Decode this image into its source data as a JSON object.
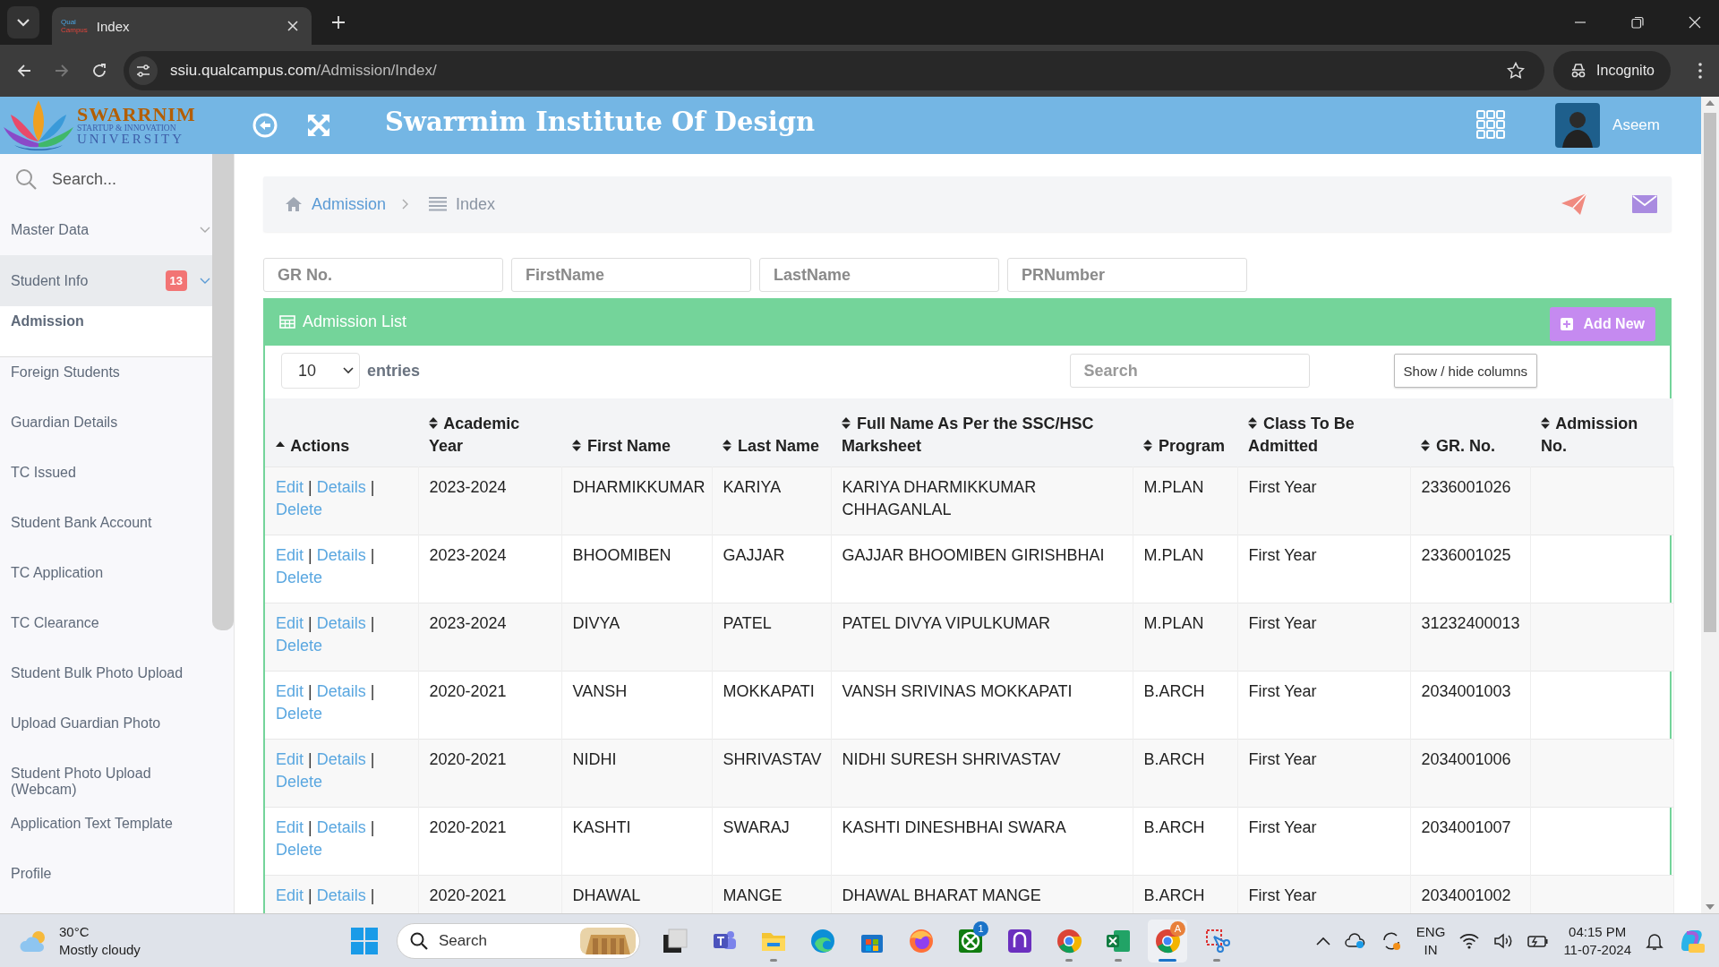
{
  "browser": {
    "tab": {
      "title": "Index",
      "favicon_top": "Qual",
      "favicon_bottom": "Campus"
    },
    "url_host": "ssiu.qualcampus.com",
    "url_path": "/Admission/Index/",
    "profile": "Incognito"
  },
  "header": {
    "logo": {
      "name": "SWARRNIM",
      "line_1": "STARTUP & INNOVATION",
      "line_2": "UNIVERSITY"
    },
    "title": "Swarrnim Institute Of Design",
    "user": "Aseem"
  },
  "sidebar": {
    "search_placeholder": "Search...",
    "items": [
      {
        "label": "Master Data",
        "expanded": false,
        "selected": false
      },
      {
        "label": "Student Info",
        "badge": "13",
        "expanded": true,
        "selected": false,
        "children": [
          {
            "label": "Admission",
            "selected": true
          },
          {
            "label": "Foreign Students",
            "selected": false
          },
          {
            "label": "Guardian Details",
            "selected": false
          },
          {
            "label": "TC Issued",
            "selected": false
          },
          {
            "label": "Student Bank Account",
            "selected": false
          },
          {
            "label": "TC Application",
            "selected": false
          },
          {
            "label": "TC Clearance",
            "selected": false
          },
          {
            "label": "Student Bulk Photo Upload",
            "selected": false
          },
          {
            "label": "Upload Guardian Photo",
            "selected": false
          },
          {
            "label": "Student Photo Upload (Webcam)",
            "selected": false
          },
          {
            "label": "Application Text Template",
            "selected": false
          },
          {
            "label": "Profile",
            "selected": false
          }
        ]
      }
    ]
  },
  "breadcrumb": [
    {
      "label": "Admission",
      "kind": "link"
    },
    {
      "label": "Index",
      "kind": "current"
    }
  ],
  "filters": [
    {
      "placeholder": "GR No."
    },
    {
      "placeholder": "FirstName"
    },
    {
      "placeholder": "LastName"
    },
    {
      "placeholder": "PRNumber"
    }
  ],
  "panel": {
    "title": "Admission List",
    "add_button": "Add New",
    "page_size": "10",
    "entries_label": "entries",
    "search_placeholder": "Search",
    "columns_button": "Show / hide columns"
  },
  "table": {
    "separator": "|",
    "columns": [
      {
        "label": "Actions",
        "sorted": true
      },
      {
        "label": "Academic Year",
        "sorted": false
      },
      {
        "label": "First Name",
        "sorted": false
      },
      {
        "label": "Last Name",
        "sorted": false
      },
      {
        "label": "Full Name As Per the SSC/HSC Marksheet",
        "sorted": false
      },
      {
        "label": "Program",
        "sorted": false
      },
      {
        "label": "Class To Be Admitted",
        "sorted": false
      },
      {
        "label": "GR. No.",
        "sorted": false
      },
      {
        "label": "Admission No.",
        "sorted": false
      }
    ],
    "rows": [
      {
        "cells": [
          [
            "Edit",
            "Details",
            "Delete"
          ],
          "2023-2024",
          "DHARMIKKUMAR",
          "KARIYA",
          "KARIYA DHARMIKKUMAR CHHAGANLAL",
          "M.PLAN",
          "First Year",
          "2336001026",
          ""
        ]
      },
      {
        "cells": [
          [
            "Edit",
            "Details",
            "Delete"
          ],
          "2023-2024",
          "BHOOMIBEN",
          "GAJJAR",
          "GAJJAR BHOOMIBEN GIRISHBHAI",
          "M.PLAN",
          "First Year",
          "2336001025",
          ""
        ]
      },
      {
        "cells": [
          [
            "Edit",
            "Details",
            "Delete"
          ],
          "2023-2024",
          "DIVYA",
          "PATEL",
          "PATEL DIVYA VIPULKUMAR",
          "M.PLAN",
          "First Year",
          "31232400013",
          ""
        ]
      },
      {
        "cells": [
          [
            "Edit",
            "Details",
            "Delete"
          ],
          "2020-2021",
          "VANSH",
          "MOKKAPATI",
          "VANSH SRIVINAS MOKKAPATI",
          "B.ARCH",
          "First Year",
          "2034001003",
          ""
        ]
      },
      {
        "cells": [
          [
            "Edit",
            "Details",
            "Delete"
          ],
          "2020-2021",
          "NIDHI",
          "SHRIVASTAV",
          "NIDHI SURESH SHRIVASTAV",
          "B.ARCH",
          "First Year",
          "2034001006",
          ""
        ]
      },
      {
        "cells": [
          [
            "Edit",
            "Details",
            "Delete"
          ],
          "2020-2021",
          "KASHTI",
          "SWARAJ",
          "KASHTI DINESHBHAI SWARA",
          "B.ARCH",
          "First Year",
          "2034001007",
          ""
        ]
      },
      {
        "cells": [
          [
            "Edit",
            "Details"
          ],
          "2020-2021",
          "DHAWAL",
          "MANGE",
          "DHAWAL BHARAT MANGE",
          "B.ARCH",
          "First Year",
          "2034001002",
          ""
        ]
      }
    ]
  },
  "taskbar": {
    "temperature": "30°C",
    "weather": "Mostly cloudy",
    "search_placeholder": "Search",
    "apps": [
      {
        "kind": "taskview",
        "running": false,
        "active": false
      },
      {
        "kind": "teams",
        "running": false,
        "active": false
      },
      {
        "kind": "files",
        "running": true,
        "active": false
      },
      {
        "kind": "edge",
        "running": false,
        "active": false
      },
      {
        "kind": "store",
        "running": false,
        "active": false
      },
      {
        "kind": "firefox",
        "running": false,
        "active": false
      },
      {
        "kind": "xbox",
        "badge": "1",
        "running": false,
        "active": false
      },
      {
        "kind": "arch",
        "running": false,
        "active": false
      },
      {
        "kind": "chrome",
        "running": true,
        "active": false
      },
      {
        "kind": "excel",
        "running": true,
        "active": false
      },
      {
        "kind": "chrome",
        "badge": "A",
        "running": true,
        "active": true
      },
      {
        "kind": "snip",
        "running": true,
        "active": false
      }
    ],
    "language": "ENG",
    "region": "IN",
    "time": "04:15 PM",
    "date": "11-07-2024"
  }
}
